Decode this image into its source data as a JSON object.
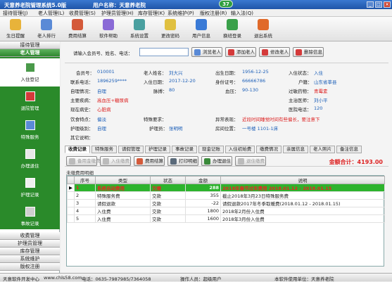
{
  "app": {
    "title": "天意养老院管理系统5.0版",
    "user_text": "用户名称：天意养老院",
    "badge": "37"
  },
  "menu": [
    "接待管理(J)",
    "老人管理(L)",
    "收费管理(S)",
    "护理员管理(H)",
    "库存管理(K)",
    "系统维护(P)",
    "版权注册(R)",
    "输入法(Q)"
  ],
  "toolbar": [
    "生日提醒",
    "老人排行",
    "费用结算",
    "软件帮助",
    "系统设置",
    "更改密码",
    "用户信息",
    "换班登录",
    "退出系统"
  ],
  "sidebar": {
    "top_heads": [
      "接待管理",
      "老人管理"
    ],
    "items": [
      "入住登记",
      "退院管理",
      "特殊服务",
      "办理退住",
      "护理记录",
      "事故记录"
    ],
    "bottom_heads": [
      "收费管理",
      "护理员管理",
      "库存管理",
      "系统维护",
      "版权注册"
    ]
  },
  "search": {
    "label": "请输入会员号、姓名、电话：",
    "value": "",
    "buttons": [
      "浏览老人",
      "添加老人",
      "修改老人",
      "删除信息"
    ]
  },
  "info": {
    "member_no_l": "会员号：",
    "member_no": "010001",
    "name_l": "老人姓名：",
    "name": "刘大兴",
    "birth_l": "出生日期：",
    "birth": "1956-12-25",
    "status_l": "入住状态：",
    "status": "入住",
    "phone_l": "联系电话：",
    "phone": "1896259****",
    "admit_l": "入住日期：",
    "admit": "2017-12-20",
    "id_l": "身份证号：",
    "id": "66666786",
    "hukou_l": "户籍：",
    "hukou": "山东省莘县",
    "self_l": "自理情况：",
    "self": "自理",
    "pulse_l": "脉搏：",
    "pulse": "80",
    "bp_l": "血压：",
    "bp": "90-130",
    "allergy_l": "过敏药物：",
    "allergy": "青霉素",
    "disease_l": "主要疾病：",
    "disease": "高血压+糖尿病",
    "doctor_l": "主治医师：",
    "doctor": "刘小平",
    "history_l": "现在病史：",
    "history": "心脏病",
    "hosp_l": "医院电话：",
    "hosp": "120",
    "diet_l": "饮食特点：",
    "diet": "偏淡",
    "special_l": "特殊要求：",
    "special": "",
    "abnormal_l": "异常表现：",
    "abnormal": "近段时间睡觉时间有些偏长，要注意下",
    "care_l": "护理级别：",
    "care": "自理",
    "nurse_l": "护理员：",
    "nurse": "张明明",
    "bed_l": "房间位置：",
    "bed": "一号楼  1101-1床",
    "other_l": "其它说明：",
    "other": ""
  },
  "tabs": [
    "收费记录",
    "特殊服务",
    "请假管理",
    "护理记录",
    "事故记录",
    "现金记账",
    "入住初始费",
    "缴费情况",
    "亲属信息",
    "老人照片",
    "备注信息"
  ],
  "subbar": {
    "buttons": [
      "备用金缴费",
      "入住缴费",
      "费用结算",
      "打印明细",
      "办理退住",
      "退住缴费"
    ],
    "total": "金额合计：4193.00"
  },
  "grid": {
    "caption": "未缴费用明细",
    "headers": [
      "序号",
      "类型",
      "状态",
      "金额",
      "说明"
    ],
    "rows": [
      [
        "1",
        "系统自动费用",
        "欠缴",
        "288",
        "2018年春节过年费用 2018.01.12 - 2018.01.15"
      ],
      [
        "2",
        "特殊服务费",
        "交款",
        "355",
        "截止2018年3月23日特殊服务费"
      ],
      [
        "3",
        "请假退款",
        "交款",
        "-22",
        "请假退款2017年冬季取暖费(2018.01.12 - 2018.01.15)"
      ],
      [
        "4",
        "入住费",
        "交款",
        "1800",
        "2018年2月份入住费"
      ],
      [
        "5",
        "入住费",
        "交款",
        "1600",
        "2018年3月份入住费"
      ]
    ]
  },
  "status": {
    "company": "天意软件开发中心",
    "web": "www.chls58.com",
    "tel": "电话：0635-7987985/7364058",
    "op": "操作人员：超级用户",
    "use": "本软件使用单位：天意养老院"
  }
}
